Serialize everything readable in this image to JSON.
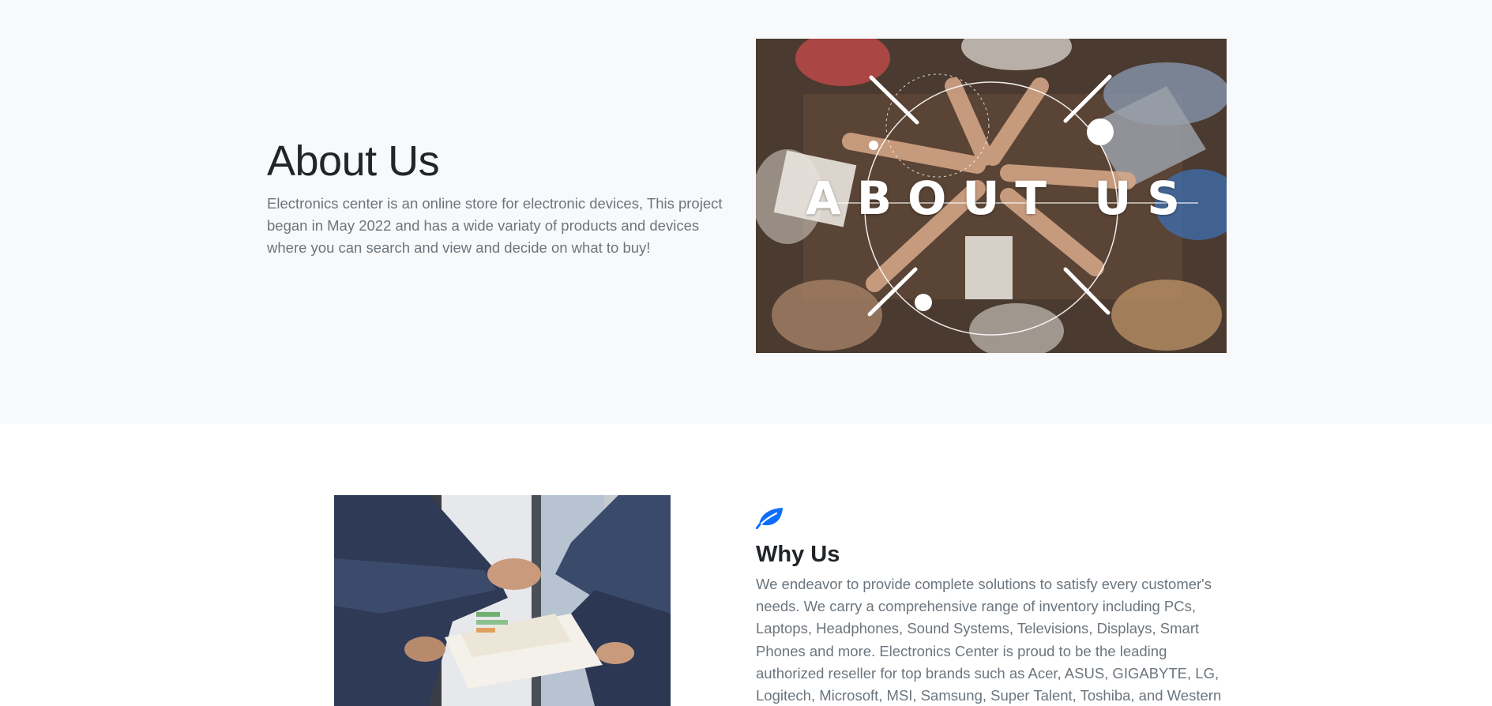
{
  "about": {
    "title": "About Us",
    "description": "Electronics center is an online store for electronic devices, This project began in May 2022 and has a wide variaty of products and devices where you can search and view and decide on what to buy!",
    "image_overlay_text": "ABOUT US"
  },
  "why_us": {
    "icon": "leaf-icon",
    "title": "Why Us",
    "description": "We endeavor to provide complete solutions to satisfy every customer's needs. We carry a comprehensive range of inventory including PCs, Laptops, Headphones, Sound Systems, Televisions, Displays, Smart Phones and more. Electronics Center is proud to be the leading authorized reseller for top brands such as Acer, ASUS, GIGABYTE, LG, Logitech, Microsoft, MSI, Samsung, Super Talent, Toshiba, and Western Digital."
  },
  "colors": {
    "about_background": "#f8f9fa",
    "accent": "#0d6efd",
    "heading": "#212529",
    "muted_text": "#6c757d"
  }
}
